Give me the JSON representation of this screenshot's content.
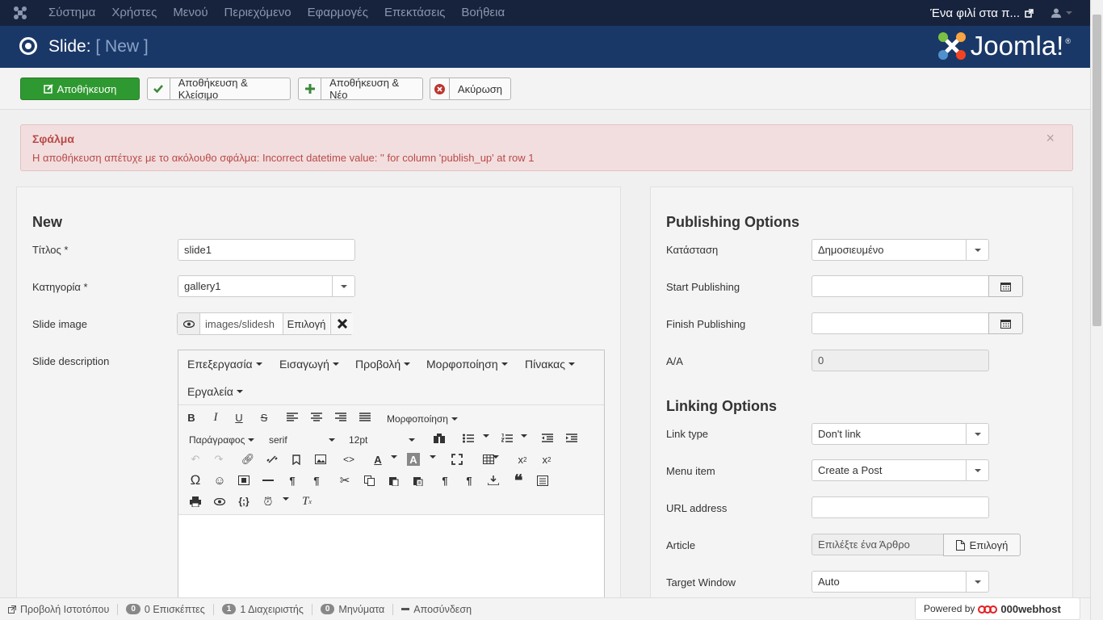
{
  "topnav": {
    "menu": [
      "Σύστημα",
      "Χρήστες",
      "Μενού",
      "Περιεχόμενο",
      "Εφαρμογές",
      "Επεκτάσεις",
      "Βοήθεια"
    ],
    "site_label": "Ένα φιλί στα π...",
    "icons": {
      "logo": "joomla-icon",
      "external": "external-link-icon",
      "user": "user-icon"
    }
  },
  "header": {
    "title": "Slide:",
    "subtitle": "[ New ]",
    "brand": "Joomla!",
    "brand_mark": "®"
  },
  "toolbar": {
    "save": "Αποθήκευση",
    "save_close": "Αποθήκευση & Κλείσιμο",
    "save_new": "Αποθήκευση & Νέο",
    "cancel": "Ακύρωση"
  },
  "alert": {
    "heading": "Σφάλμα",
    "message": "Η αποθήκευση απέτυχε με το ακόλουθο σφάλμα: Incorrect datetime value: '' for column 'publish_up' at row 1",
    "close": "×"
  },
  "left": {
    "heading": "New",
    "title_label": "Τίτλος *",
    "title_value": "slide1",
    "category_label": "Κατηγορία *",
    "category_value": "gallery1",
    "image_label": "Slide image",
    "image_value": "images/slidesh",
    "image_select": "Επιλογή",
    "desc_label": "Slide description"
  },
  "editor": {
    "menus": [
      "Επεξεργασία",
      "Εισαγωγή",
      "Προβολή",
      "Μορφοποίηση",
      "Πίνακας"
    ],
    "menus2": [
      "Εργαλεία"
    ],
    "format_dropdown": "Μορφοποίηση",
    "paragraph": "Παράγραφος",
    "font": "serif",
    "size": "12pt"
  },
  "right": {
    "publishing_heading": "Publishing Options",
    "status_label": "Κατάσταση",
    "status_value": "Δημοσιευμένο",
    "start_label": "Start Publishing",
    "finish_label": "Finish Publishing",
    "id_label": "A/A",
    "id_value": "0",
    "linking_heading": "Linking Options",
    "link_type_label": "Link type",
    "link_type_value": "Don't link",
    "menu_item_label": "Menu item",
    "menu_item_value": "Create a Post",
    "url_label": "URL address",
    "article_label": "Article",
    "article_placeholder": "Επιλέξτε ένα Άρθρο",
    "article_select": "Επιλογή",
    "target_label": "Target Window",
    "target_value": "Auto"
  },
  "status": {
    "view_site": "Προβολή Ιστοτόπου",
    "visitors_count": "0",
    "visitors": "0 Επισκέπτες",
    "admins_count": "1",
    "admins": "1 Διαχειριστής",
    "messages_count": "0",
    "messages": "Μηνύματα",
    "logout": "Αποσύνδεση",
    "powered": "Powered by",
    "host": "000webhost"
  },
  "colors": {
    "nav": "#17233d",
    "header": "#1a3867",
    "save": "#2f9931",
    "alert_bg": "#f2dede",
    "alert_text": "#b94a48"
  }
}
